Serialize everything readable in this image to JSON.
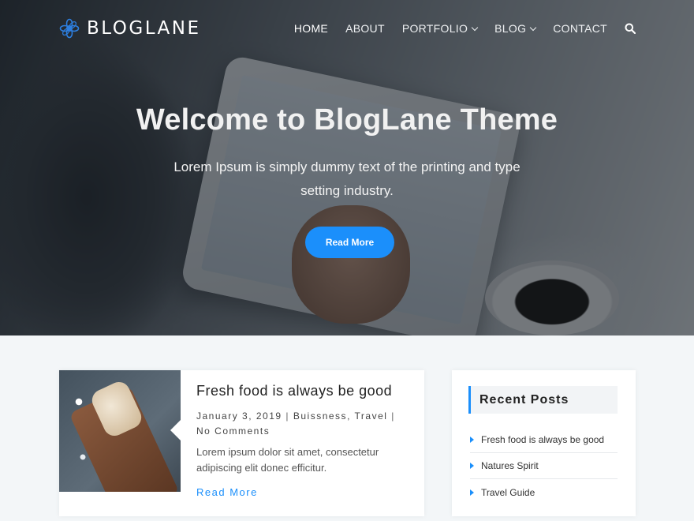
{
  "brand": {
    "name": "BLOGLANE",
    "accent": "#1b8ffb"
  },
  "nav": {
    "items": [
      {
        "label": "HOME",
        "dropdown": false,
        "active": true
      },
      {
        "label": "ABOUT",
        "dropdown": false
      },
      {
        "label": "PORTFOLIO",
        "dropdown": true
      },
      {
        "label": "BLOG",
        "dropdown": true
      },
      {
        "label": "CONTACT",
        "dropdown": false
      }
    ],
    "search_icon": "search-icon"
  },
  "hero": {
    "title": "Welcome to BlogLane Theme",
    "subtitle": "Lorem Ipsum is simply dummy text of the printing and type setting industry.",
    "button_label": "Read More"
  },
  "post": {
    "title": "Fresh food is always be good",
    "date": "January 3, 2019",
    "categories": [
      "Buissness",
      "Travel"
    ],
    "comments": "No Comments",
    "excerpt": "Lorem ipsum dolor sit amet, consectetur adipiscing elit donec efficitur.",
    "read_more": "Read More"
  },
  "sidebar": {
    "recent_posts": {
      "title": "Recent Posts",
      "items": [
        "Fresh food is always be good",
        "Natures Spirit",
        "Travel Guide"
      ]
    }
  }
}
